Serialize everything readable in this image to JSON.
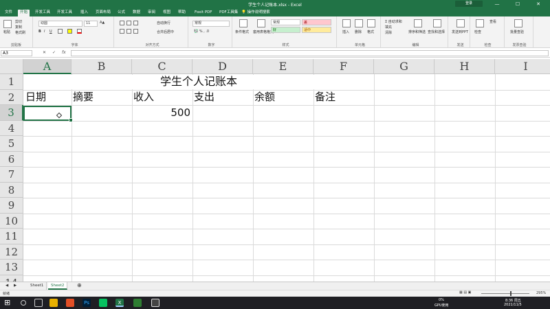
{
  "window": {
    "title": "学生个人记账本.xlsx - Excel",
    "user_badge": "登录",
    "controls": [
      "—",
      "☐",
      "✕"
    ]
  },
  "ribbon_tabs": [
    "文件",
    "开始",
    "开发工具",
    "开发工具",
    "插入",
    "页面布局",
    "公式",
    "数据",
    "审阅",
    "视图",
    "帮助",
    "Foxit PDF",
    "PDF工具集",
    "操作说明搜索"
  ],
  "ribbon": {
    "clipboard": {
      "paste": "粘贴",
      "cut": "剪切",
      "copy": "复制",
      "format_painter": "格式刷",
      "label": "剪贴板"
    },
    "font": {
      "name": "幼圆",
      "size": "11",
      "bold": "B",
      "italic": "I",
      "underline": "U",
      "label": "字体"
    },
    "alignment": {
      "wrap": "自动换行",
      "merge": "合并后居中",
      "label": "对齐方式"
    },
    "number": {
      "format": "常规",
      "label": "数字"
    },
    "styles": {
      "conditional": "条件格式",
      "table": "套用表格格式",
      "normal": "常规",
      "bad": "差",
      "good": "好",
      "neutral": "适中",
      "label": "样式"
    },
    "cells": {
      "insert": "插入",
      "delete": "删除",
      "format": "格式",
      "label": "单元格"
    },
    "editing": {
      "autosum": "自动求和",
      "fill": "填充",
      "clear": "清除",
      "sort": "排序和筛选",
      "find": "查找和选择",
      "label": "编辑"
    },
    "send": {
      "ppt": "发送到PPT",
      "label": "发送"
    },
    "check": {
      "label": "检查",
      "a": "检查",
      "b": "查看"
    },
    "invoice": {
      "label": "发票查验",
      "a": "批量查验"
    }
  },
  "formula_bar": {
    "name_box": "A3",
    "cancel": "✕",
    "enter": "✓",
    "fx": "fx",
    "formula": ""
  },
  "columns": [
    "A",
    "B",
    "C",
    "D",
    "E",
    "F",
    "G",
    "H",
    "I"
  ],
  "rows": [
    "1",
    "2",
    "3",
    "4",
    "5",
    "6",
    "7",
    "8",
    "9",
    "10",
    "11",
    "12",
    "13",
    "14"
  ],
  "cells": {
    "title": "学生个人记账本",
    "header_date": "日期",
    "header_summary": "摘要",
    "header_income": "收入",
    "header_expense": "支出",
    "header_balance": "余额",
    "header_note": "备注",
    "c3": "500"
  },
  "sheets": [
    "Sheet1",
    "Sheet2"
  ],
  "active_sheet": "Sheet2",
  "status": {
    "mode": "就绪",
    "zoom": "295%"
  },
  "taskbar": {
    "cpu": "0%",
    "cpu_label": "GPU使用",
    "time": "8:36 周五",
    "date": "2021/11/5"
  },
  "colors": {
    "accent": "#217346"
  }
}
